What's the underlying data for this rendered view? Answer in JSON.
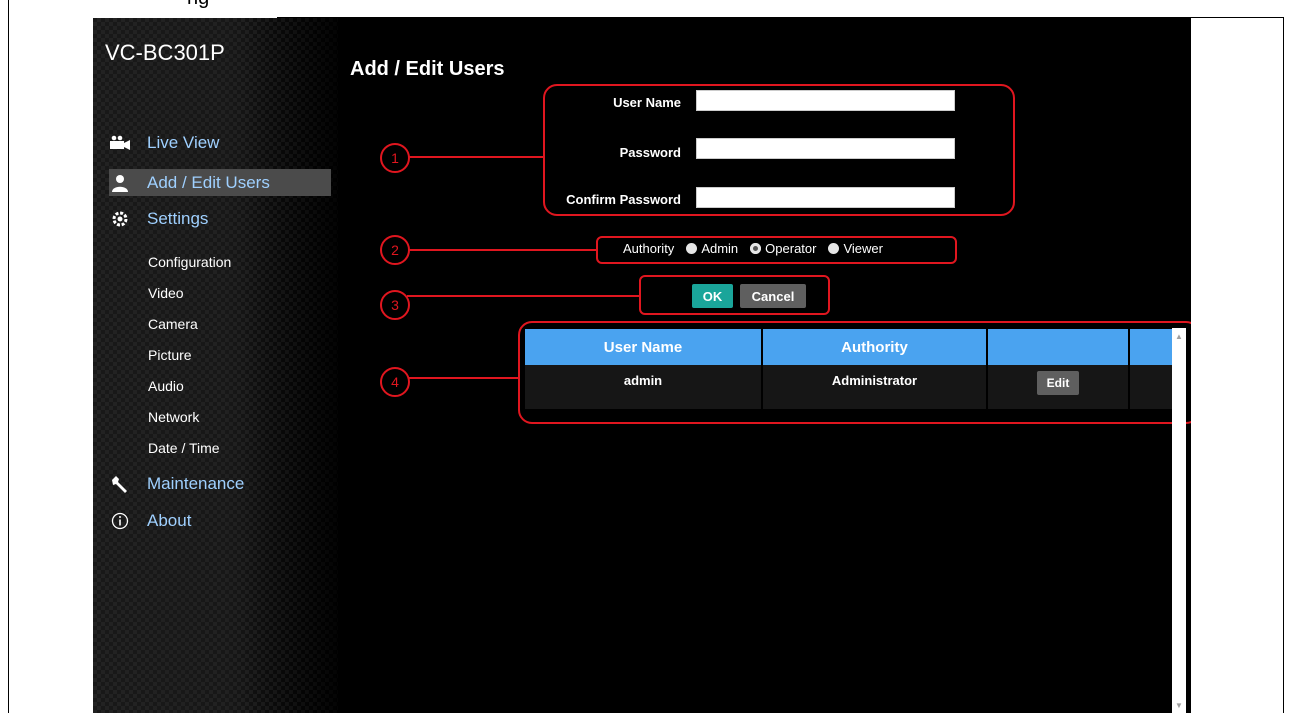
{
  "page_caption_fragment": "ng",
  "app": {
    "device_name": "VC-BC301P",
    "page_title": "Add / Edit Users"
  },
  "sidebar": {
    "items": [
      {
        "label": "Live View",
        "icon": "camera-icon"
      },
      {
        "label": "Add / Edit Users",
        "icon": "user-icon",
        "active": true
      },
      {
        "label": "Settings",
        "icon": "gear-icon"
      },
      {
        "label": "Maintenance",
        "icon": "wrench-icon"
      },
      {
        "label": "About",
        "icon": "info-icon"
      }
    ],
    "settings_subitems": [
      "Configuration",
      "Video",
      "Camera",
      "Picture",
      "Audio",
      "Network",
      "Date / Time"
    ]
  },
  "form": {
    "username_label": "User Name",
    "password_label": "Password",
    "confirm_label": "Confirm Password",
    "username_value": "",
    "password_value": "",
    "confirm_value": ""
  },
  "authority": {
    "label": "Authority",
    "options": [
      "Admin",
      "Operator",
      "Viewer"
    ],
    "selected": "Operator"
  },
  "buttons": {
    "ok": "OK",
    "cancel": "Cancel"
  },
  "table": {
    "headers": [
      "User Name",
      "Authority",
      "",
      ""
    ],
    "rows": [
      {
        "user": "admin",
        "authority": "Administrator",
        "action": "Edit"
      }
    ]
  },
  "callouts": [
    "1",
    "2",
    "3",
    "4"
  ],
  "colors": {
    "accent_link": "#9fd0ff",
    "table_header": "#4aa3f0",
    "ok_button": "#1aa59a",
    "callout_red": "#e0161f"
  }
}
